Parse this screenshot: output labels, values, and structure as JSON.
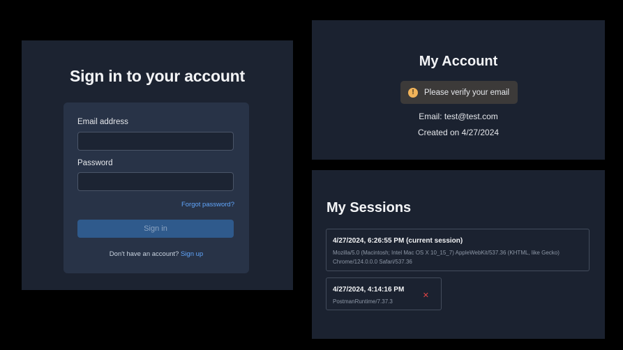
{
  "signin": {
    "title": "Sign in to your account",
    "email_label": "Email address",
    "email_value": "",
    "password_label": "Password",
    "password_value": "",
    "forgot_link": "Forgot password?",
    "submit_label": "Sign in",
    "no_account_text": "Don't have an account?",
    "signup_link": "Sign up"
  },
  "account": {
    "title": "My Account",
    "alert_text": "Please verify your email",
    "alert_icon": "warning-icon",
    "email_line": "Email: test@test.com",
    "created_line": "Created on 4/27/2024"
  },
  "sessions": {
    "title": "My Sessions",
    "items": [
      {
        "title": "4/27/2024, 6:26:55 PM (current session)",
        "user_agent_line1": "Mozilla/5.0 (Macintosh; Intel Mac OS X 10_15_7) AppleWebKit/537.36 (KHTML, like Gecko)",
        "user_agent_line2": "Chrome/124.0.0.0 Safari/537.36"
      },
      {
        "title": "4/27/2024, 4:14:16 PM",
        "user_agent_line1": "PostmanRuntime/7.37.3",
        "remove_icon": "✕"
      }
    ]
  },
  "colors": {
    "background": "#000000",
    "panel": "#1b2230",
    "card": "#283347",
    "link": "#60a5fa",
    "button": "#2f5a8c",
    "warning": "#f2b45a",
    "danger": "#e04444"
  }
}
